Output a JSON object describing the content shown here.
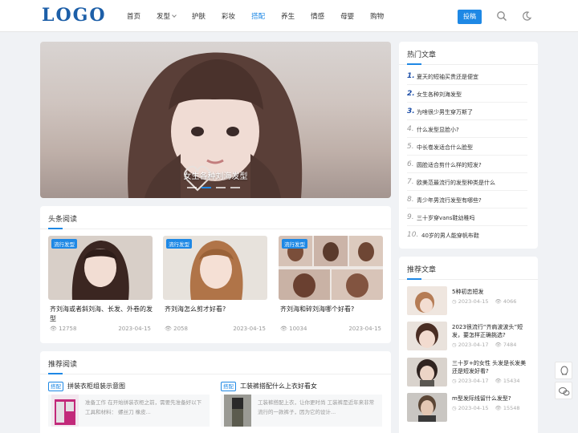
{
  "header": {
    "logo": "LOGO",
    "nav": [
      {
        "label": "首页"
      },
      {
        "label": "发型",
        "dropdown": true
      },
      {
        "label": "护肤"
      },
      {
        "label": "彩妆"
      },
      {
        "label": "搭配",
        "active": true
      },
      {
        "label": "养生"
      },
      {
        "label": "情感"
      },
      {
        "label": "母婴"
      },
      {
        "label": "购物"
      }
    ],
    "post_button": "投稿",
    "icons": [
      "search-icon",
      "moon-icon"
    ],
    "accent": "#1e88e5"
  },
  "banner": {
    "caption": "女生各种刘海发型",
    "slides": 4,
    "active_slide": 2
  },
  "headlines": {
    "title": "头条阅读",
    "articles": [
      {
        "badge": "流行发型",
        "title": "齐刘海或者斜刘海、长发、外卷的发型",
        "views": "12758",
        "date": "2023-04-15"
      },
      {
        "badge": "流行发型",
        "title": "齐刘海怎么剪才好看?",
        "views": "2058",
        "date": "2023-04-15"
      },
      {
        "badge": "流行发型",
        "title": "齐刘海和碎刘海哪个好看?",
        "views": "10034",
        "date": "2023-04-15"
      }
    ]
  },
  "recommend_read": {
    "title": "推荐阅读",
    "items": [
      {
        "tag": "搭配",
        "title": "拼装衣柜组装示意图",
        "desc": "准备工作 在开始拼装衣柜之前，需要先准备好以下工具和材料： 螺丝刀 橡皮..."
      },
      {
        "tag": "搭配",
        "title": "工装裤搭配什么上衣好看女",
        "desc": "工装裤搭配上衣，让你更时尚 工装裤是近年来非常流行的一款裤子，因为它的设计..."
      }
    ]
  },
  "hot": {
    "title": "热门文章",
    "items": [
      {
        "num": "1.",
        "text": "夏天的短袖买贵还是便宜"
      },
      {
        "num": "2.",
        "text": "女生各种刘海发型"
      },
      {
        "num": "3.",
        "text": "为啥很少男生穿万斯了"
      },
      {
        "num": "4.",
        "text": "什么发型显脸小?"
      },
      {
        "num": "5.",
        "text": "中长卷发适合什么脸型"
      },
      {
        "num": "6.",
        "text": "圆脸适合剪什么样的短发?"
      },
      {
        "num": "7.",
        "text": "欧美范最流行的发型种类是什么"
      },
      {
        "num": "8.",
        "text": "青少年男流行发型有哪些?"
      },
      {
        "num": "9.",
        "text": "三十岁穿vans鞋幼稚吗"
      },
      {
        "num": "10.",
        "text": "40岁的男人能穿帆布鞋"
      }
    ]
  },
  "recommended": {
    "title": "推荐文章",
    "items": [
      {
        "title": "5种初恋短发",
        "date": "2023-04-15",
        "views": "4066"
      },
      {
        "title": "2023很流行“齐肩波波头”短发，要怎样正确挑选?",
        "date": "2023-04-17",
        "views": "7484"
      },
      {
        "title": "三十岁+的女性 头发是长发美还是短发好看?",
        "date": "2023-04-17",
        "views": "15434"
      },
      {
        "title": "m型发际线留什么发型?",
        "date": "2023-04-15",
        "views": "15548"
      }
    ]
  }
}
